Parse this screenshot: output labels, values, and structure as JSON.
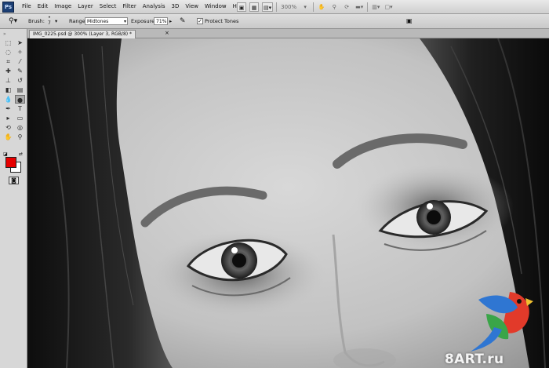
{
  "app": {
    "logo": "Ps"
  },
  "menu": [
    "File",
    "Edit",
    "Image",
    "Layer",
    "Select",
    "Filter",
    "Analysis",
    "3D",
    "View",
    "Window",
    "Help"
  ],
  "appbar": {
    "zoom": "300%"
  },
  "options": {
    "brush_label": "Brush:",
    "brush_size": "7",
    "range_label": "Range:",
    "range_value": "Midtones",
    "exposure_label": "Exposure:",
    "exposure_value": "71%",
    "protect_tones_label": "Protect Tones",
    "protect_tones_checked": true
  },
  "document": {
    "tab_title": "IMG_0225.psd @ 300% (Layer 3, RGB/8) *"
  },
  "colors": {
    "foreground": "#e60000",
    "background": "#ffffff"
  },
  "watermark": {
    "text": "8ART.ru"
  },
  "tools": [
    "move-icon",
    "marquee-icon",
    "lasso-icon",
    "quick-select-icon",
    "crop-icon",
    "eyedropper-icon",
    "healing-icon",
    "brush-icon",
    "clone-stamp-icon",
    "history-brush-icon",
    "eraser-icon",
    "gradient-icon",
    "blur-icon",
    "burn-icon",
    "pen-icon",
    "type-icon",
    "path-select-icon",
    "shape-icon",
    "3d-rotate-icon",
    "3d-orbit-icon",
    "hand-icon",
    "zoom-icon"
  ]
}
